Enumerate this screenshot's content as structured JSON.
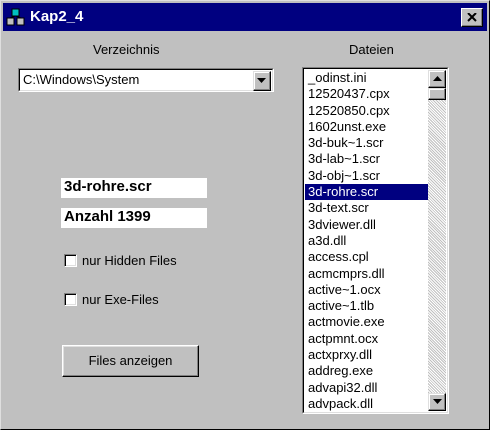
{
  "window": {
    "title": "Kap2_4"
  },
  "labels": {
    "directory": "Verzeichnis",
    "files": "Dateien"
  },
  "directory_combo": {
    "value": "C:\\Windows\\System"
  },
  "selected_file": "3d-rohre.scr",
  "count_text": "Anzahl 1399",
  "checkboxes": [
    {
      "label": "nur Hidden Files",
      "checked": false
    },
    {
      "label": "nur Exe-Files",
      "checked": false
    }
  ],
  "show_button": {
    "label": "Files anzeigen"
  },
  "file_list": {
    "items": [
      "_odinst.ini",
      "12520437.cpx",
      "12520850.cpx",
      "1602unst.exe",
      "3d-buk~1.scr",
      "3d-lab~1.scr",
      "3d-obj~1.scr",
      "3d-rohre.scr",
      "3d-text.scr",
      "3dviewer.dll",
      "a3d.dll",
      "access.cpl",
      "acmcmprs.dll",
      "active~1.ocx",
      "active~1.tlb",
      "actmovie.exe",
      "actpmnt.ocx",
      "actxprxy.dll",
      "addreg.exe",
      "advapi32.dll",
      "advpack.dll"
    ],
    "selected_index": 7
  },
  "colors": {
    "titlebar": "#000080",
    "selection": "#000080",
    "face": "#c0c0c0"
  }
}
